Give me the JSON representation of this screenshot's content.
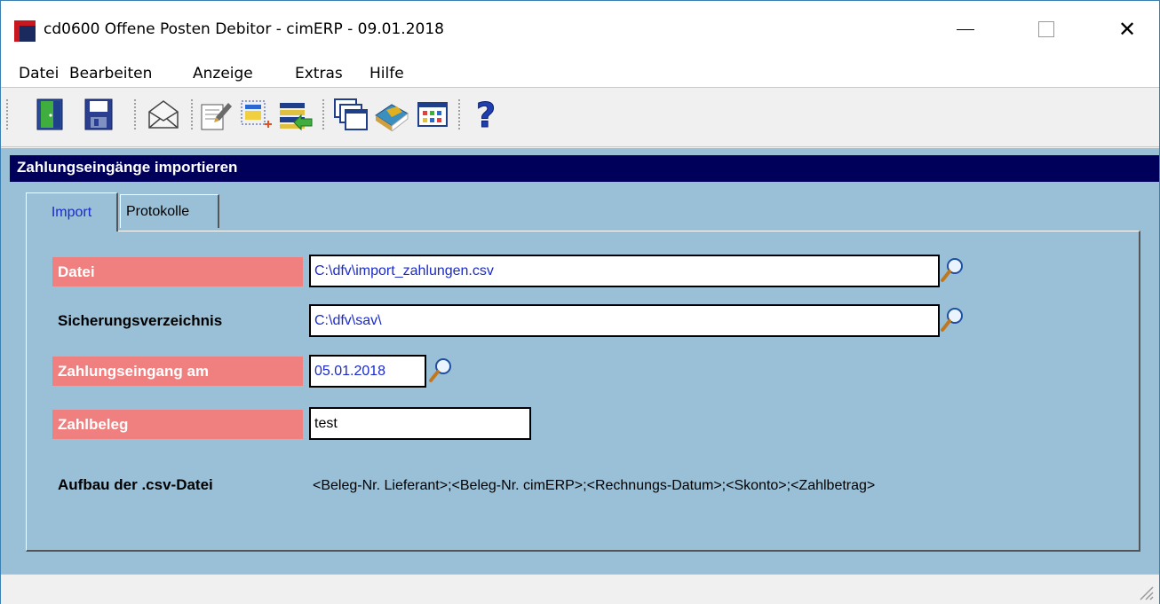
{
  "window": {
    "title": "cd0600 Offene Posten Debitor - cimERP - 09.01.2018"
  },
  "menu": {
    "items": [
      {
        "label": "Datei"
      },
      {
        "label": "Bearbeiten"
      },
      {
        "label": "Anzeige"
      },
      {
        "label": "Extras"
      },
      {
        "label": "Hilfe"
      }
    ]
  },
  "toolbar": {
    "buttons": [
      "exit-door-icon",
      "save-disk-icon",
      "mail-envelope-icon",
      "edit-note-icon",
      "new-record-icon",
      "import-list-icon",
      "windows-icon",
      "book-icon",
      "calendar-grid-icon",
      "help-question-icon"
    ]
  },
  "section": {
    "title": "Zahlungseingänge importieren"
  },
  "tabs": [
    {
      "label": "Import",
      "active": true
    },
    {
      "label": "Protokolle",
      "active": false
    }
  ],
  "form": {
    "datei": {
      "label": "Datei",
      "value": "C:\\dfv\\import_zahlungen.csv"
    },
    "sicherung": {
      "label": "Sicherungsverzeichnis",
      "value": "C:\\dfv\\sav\\"
    },
    "zahlungseingang": {
      "label": "Zahlungseingang am",
      "value": "05.01.2018"
    },
    "zahlbeleg": {
      "label": "Zahlbeleg",
      "value": "test"
    },
    "aufbau": {
      "label": "Aufbau der .csv-Datei",
      "value": "<Beleg-Nr. Lieferant>;<Beleg-Nr. cimERP>;<Rechnungs-Datum>;<Skonto>;<Zahlbetrag>"
    }
  },
  "colors": {
    "header_bg": "#00005a",
    "content_bg": "#9ac0d8",
    "required_label_bg": "#f08080",
    "field_text": "#1a2acb"
  }
}
